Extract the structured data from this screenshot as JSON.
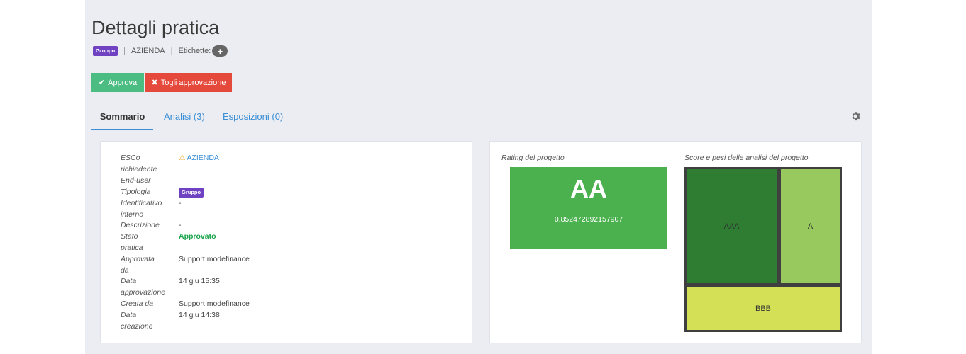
{
  "header": {
    "title": "Dettagli pratica",
    "type_badge": "Gruppo",
    "entity": "AZIENDA",
    "tags_label": "Etichette:",
    "separator": "|"
  },
  "actions": {
    "approve_label": "Approva",
    "unapprove_label": "Togli approvazione"
  },
  "tabs": [
    {
      "label": "Sommario",
      "active": true
    },
    {
      "label": "Analisi (3)",
      "active": false
    },
    {
      "label": "Esposizioni (0)",
      "active": false
    }
  ],
  "summary": {
    "fields": [
      {
        "label": "ESCo richiedente",
        "value": "AZIENDA"
      },
      {
        "label": "End-user",
        "value": ""
      },
      {
        "label": "Tipologia",
        "value": "Gruppo"
      },
      {
        "label": "Identificativo interno",
        "value": "-"
      },
      {
        "label": "Descrizione",
        "value": "-"
      },
      {
        "label": "Stato pratica",
        "value": "Approvato"
      },
      {
        "label": "Approvata da",
        "value": "Support modefinance"
      },
      {
        "label": "Data approvazione",
        "value": "14 giu 15:35"
      },
      {
        "label": "Creata da",
        "value": "Support modefinance"
      },
      {
        "label": "Data creazione",
        "value": "14 giu 14:38"
      }
    ],
    "label_lines": {
      "esco": [
        "ESCo",
        "richiedente"
      ],
      "enduser": [
        "End-user"
      ],
      "tipologia": [
        "Tipologia"
      ],
      "identificativo": [
        "Identificativo",
        "interno"
      ],
      "descrizione": [
        "Descrizione"
      ],
      "stato": [
        "Stato",
        "pratica"
      ],
      "approvata": [
        "Approvata",
        "da"
      ],
      "data_appr": [
        "Data",
        "approvazione"
      ],
      "creata": [
        "Creata da"
      ],
      "data_creaz": [
        "Data",
        "creazione"
      ]
    }
  },
  "rating": {
    "caption": "Rating del progetto",
    "grade": "AA",
    "score": "0.852472892157907",
    "color": "#4bb04e"
  },
  "scores": {
    "caption": "Score e pesi delle analisi del progetto",
    "cells": [
      {
        "label": "AAA",
        "color": "#2e7d32"
      },
      {
        "label": "A",
        "color": "#97c95e"
      },
      {
        "label": "BBB",
        "color": "#d4e157"
      }
    ]
  },
  "colors": {
    "approve": "#4cbd82",
    "unapprove": "#e4493c",
    "link": "#3a8fd6",
    "badge": "#6f42c1",
    "approved": "#18a24a"
  }
}
